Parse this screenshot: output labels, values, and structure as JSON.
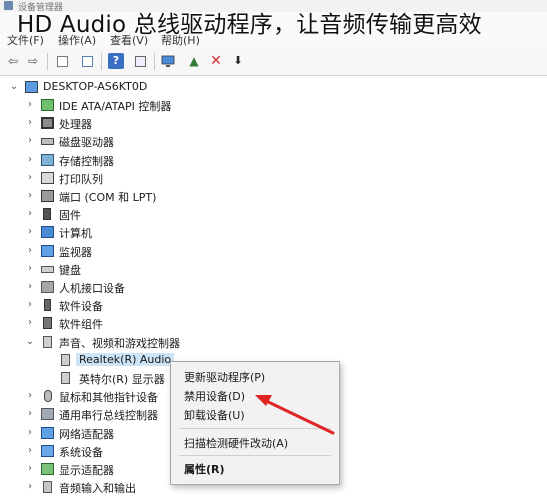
{
  "window": {
    "title": "设备管理器"
  },
  "headline": "HD Audio 总线驱动程序，让音频传输更高效",
  "menu": [
    {
      "label": "文件(F)"
    },
    {
      "label": "操作(A)"
    },
    {
      "label": "查看(V)"
    },
    {
      "label": "帮助(H)"
    }
  ],
  "toolbar": [
    {
      "icon": "back-arrow-icon",
      "glyph": "⇦"
    },
    {
      "icon": "forward-arrow-icon",
      "glyph": "⇨"
    },
    {
      "icon": "properties-icon",
      "glyph": ""
    },
    {
      "icon": "details-icon",
      "glyph": ""
    },
    {
      "icon": "help-icon",
      "glyph": "?"
    },
    {
      "icon": "view-icon",
      "glyph": ""
    },
    {
      "icon": "computer-icon",
      "glyph": ""
    },
    {
      "icon": "update-driver-icon",
      "glyph": "▲"
    },
    {
      "icon": "uninstall-icon",
      "glyph": "✕"
    },
    {
      "icon": "download-icon",
      "glyph": "⬇"
    }
  ],
  "tree": {
    "root": "DESKTOP-AS6KT0D",
    "items": [
      {
        "label": "IDE ATA/ATAPI 控制器",
        "icon": "ide-controller-icon",
        "expanded": false
      },
      {
        "label": "处理器",
        "icon": "processor-icon",
        "expanded": false
      },
      {
        "label": "磁盘驱动器",
        "icon": "disk-drive-icon",
        "expanded": false
      },
      {
        "label": "存储控制器",
        "icon": "storage-controller-icon",
        "expanded": false
      },
      {
        "label": "打印队列",
        "icon": "printer-icon",
        "expanded": false
      },
      {
        "label": "端口 (COM 和 LPT)",
        "icon": "port-icon",
        "expanded": false
      },
      {
        "label": "固件",
        "icon": "firmware-icon",
        "expanded": false
      },
      {
        "label": "计算机",
        "icon": "computer-icon",
        "expanded": false
      },
      {
        "label": "监视器",
        "icon": "monitor-icon",
        "expanded": false
      },
      {
        "label": "键盘",
        "icon": "keyboard-icon",
        "expanded": false
      },
      {
        "label": "人机接口设备",
        "icon": "hid-icon",
        "expanded": false
      },
      {
        "label": "软件设备",
        "icon": "software-device-icon",
        "expanded": false
      },
      {
        "label": "软件组件",
        "icon": "software-component-icon",
        "expanded": false
      },
      {
        "label": "声音、视频和游戏控制器",
        "icon": "speaker-icon",
        "expanded": true
      },
      {
        "label": "Realtek(R) Audio",
        "icon": "speaker-icon",
        "child": true,
        "selected": true
      },
      {
        "label": "英特尔(R) 显示器",
        "icon": "speaker-icon",
        "child": true
      },
      {
        "label": "鼠标和其他指针设备",
        "icon": "mouse-icon",
        "expanded": false
      },
      {
        "label": "通用串行总线控制器",
        "icon": "usb-icon",
        "expanded": false
      },
      {
        "label": "网络适配器",
        "icon": "network-icon",
        "expanded": false
      },
      {
        "label": "系统设备",
        "icon": "system-device-icon",
        "expanded": false
      },
      {
        "label": "显示适配器",
        "icon": "display-adapter-icon",
        "expanded": false
      },
      {
        "label": "音频输入和输出",
        "icon": "audio-io-icon",
        "expanded": false
      }
    ]
  },
  "context_menu": {
    "items": [
      {
        "label": "更新驱动程序(P)",
        "bold": false
      },
      {
        "label": "禁用设备(D)",
        "bold": false
      },
      {
        "label": "卸载设备(U)",
        "bold": false
      },
      {
        "label": "扫描检测硬件改动(A)",
        "bold": false
      },
      {
        "label": "属性(R)",
        "bold": true
      }
    ]
  },
  "colors": {
    "selection": "#cce4f7",
    "annotation_arrow": "#e02424",
    "uninstall_icon": "#d32f2f",
    "update_icon": "#2e7d32"
  }
}
